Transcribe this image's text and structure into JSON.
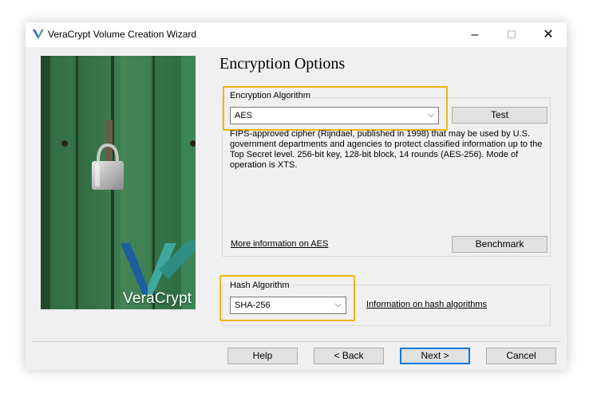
{
  "window": {
    "title": "VeraCrypt Volume Creation Wizard",
    "controls": {
      "minimize": "–",
      "maximize": "☐",
      "close": "✕"
    }
  },
  "image_panel": {
    "brand_text": "VeraCrypt",
    "icon": "padlock-on-green-door-photo"
  },
  "page": {
    "heading": "Encryption Options"
  },
  "encryption": {
    "group_label": "Encryption Algorithm",
    "selected": "AES",
    "test_label": "Test",
    "description": "FIPS-approved cipher (Rijndael, published in 1998) that may be used by U.S. government departments and agencies to protect classified information up to the Top Secret level. 256-bit key, 128-bit block, 14 rounds (AES-256). Mode of operation is XTS.",
    "more_info_link": "More information on AES",
    "benchmark_label": "Benchmark"
  },
  "hash": {
    "group_label": "Hash Algorithm",
    "selected": "SHA-256",
    "info_link": "Information on hash algorithms"
  },
  "footer": {
    "help": "Help",
    "back": "< Back",
    "next": "Next >",
    "cancel": "Cancel"
  },
  "colors": {
    "highlight": "#f3b416",
    "focus_blue": "#0078d7",
    "logo_teal": "#3fa9a0",
    "logo_blue": "#1d5f9e"
  }
}
